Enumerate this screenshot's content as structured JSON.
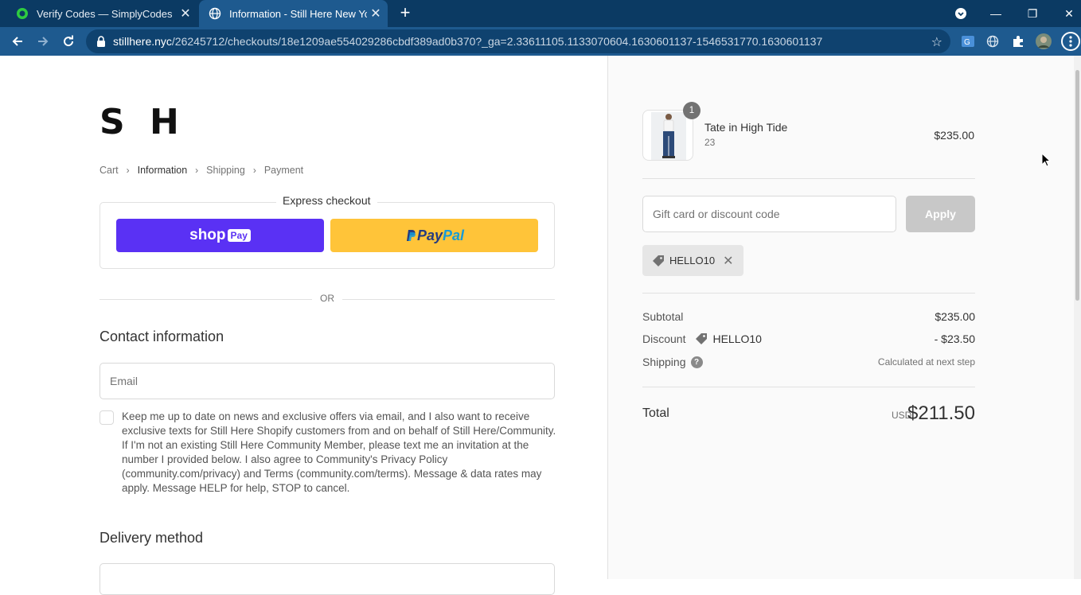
{
  "browser": {
    "tabs": [
      {
        "title": "Verify Codes — SimplyCodes",
        "icon": "simplycodes-icon"
      },
      {
        "title": "Information - Still Here New York",
        "icon": "globe-icon"
      }
    ],
    "url_host": "stillhere.nyc",
    "url_path": "/26245712/checkouts/18e1209ae554029286cbdf389ad0b370?_ga=2.33611105.1133070604.1630601137-1546531770.1630601137"
  },
  "store": {
    "logo": "S H"
  },
  "breadcrumb": {
    "cart": "Cart",
    "information": "Information",
    "shipping": "Shipping",
    "payment": "Payment"
  },
  "express": {
    "title": "Express checkout",
    "shoppay_text": "shop",
    "shoppay_badge": "Pay",
    "paypal_a": "Pay",
    "paypal_b": "Pal"
  },
  "or_text": "OR",
  "contact": {
    "heading": "Contact information",
    "email_placeholder": "Email",
    "consent": "Keep me up to date on news and exclusive offers via email, and I also want to receive exclusive texts for Still Here Shopify customers from and on behalf of Still Here/Community. If I'm not an existing Still Here Community Member, please text me an invitation at the number I provided below. I also agree to Community's Privacy Policy (community.com/privacy) and Terms (community.com/terms). Message & data rates may apply. Message HELP for help, STOP to cancel."
  },
  "delivery": {
    "heading": "Delivery method"
  },
  "order": {
    "item": {
      "name": "Tate in High Tide",
      "variant": "23",
      "price": "$235.00",
      "quantity": "1"
    },
    "discount_placeholder": "Gift card or discount code",
    "apply_label": "Apply",
    "applied_code": "HELLO10",
    "subtotal_label": "Subtotal",
    "subtotal_value": "$235.00",
    "discount_label": "Discount",
    "discount_code": "HELLO10",
    "discount_value": "- $23.50",
    "shipping_label": "Shipping",
    "shipping_value": "Calculated at next step",
    "total_label": "Total",
    "currency": "USD",
    "total_value": "$211.50"
  },
  "colors": {
    "chrome": "#0b3a63",
    "toolbar": "#1e5a8f",
    "shoppay": "#5a31f4",
    "paypal": "#ffc439"
  }
}
